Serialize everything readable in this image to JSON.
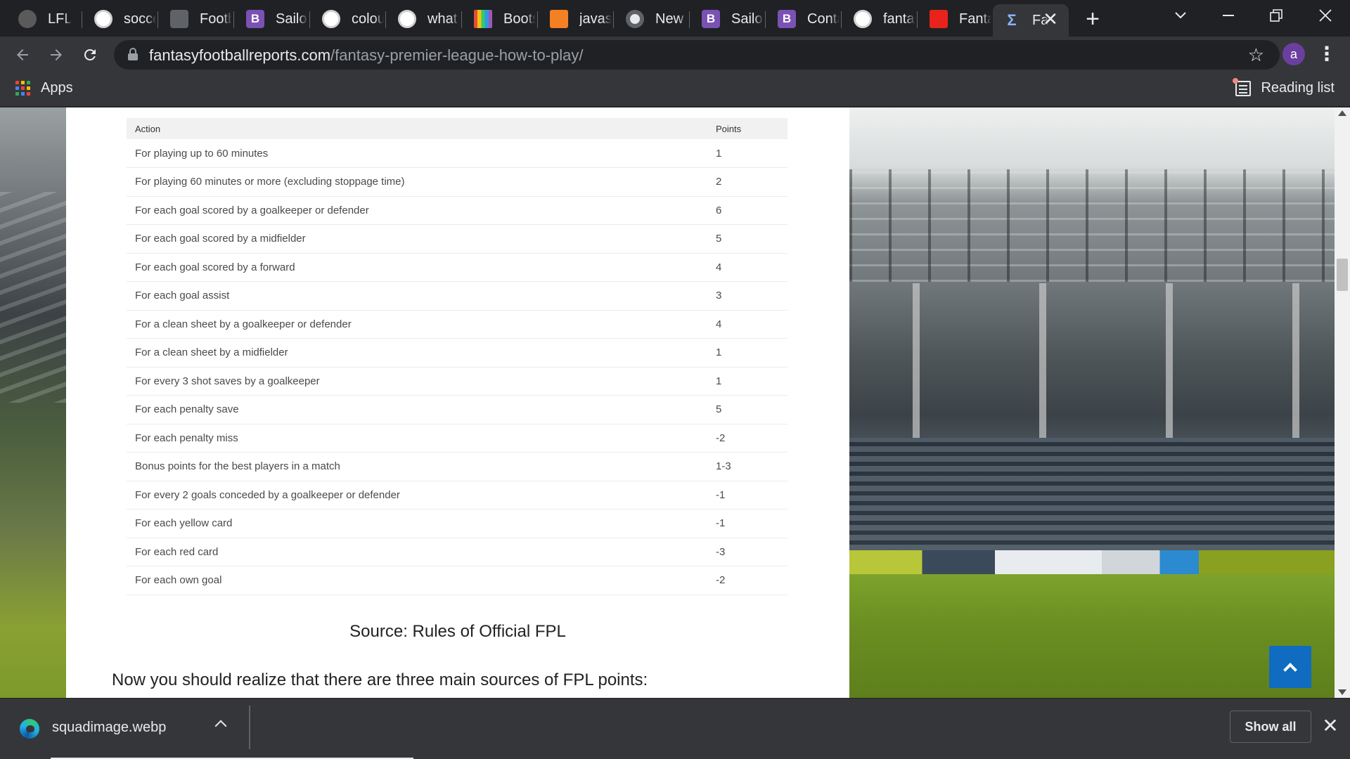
{
  "browser": {
    "tabs": [
      {
        "title": "LFL",
        "favicon": "lfl-logo-icon"
      },
      {
        "title": "soccer",
        "favicon": "google-icon"
      },
      {
        "title": "Footb",
        "favicon": "football-icon"
      },
      {
        "title": "Sailor",
        "favicon": "bootstrap-icon"
      },
      {
        "title": "colour",
        "favicon": "google-icon"
      },
      {
        "title": "what i",
        "favicon": "google-icon"
      },
      {
        "title": "Boots",
        "favicon": "colour-stripes-icon"
      },
      {
        "title": "javasc",
        "favicon": "stackoverflow-icon"
      },
      {
        "title": "New T",
        "favicon": "chrome-icon"
      },
      {
        "title": "Sailor",
        "favicon": "bootstrap-icon"
      },
      {
        "title": "Conta",
        "favicon": "bootstrap-icon"
      },
      {
        "title": "fantas",
        "favicon": "google-icon"
      },
      {
        "title": "Fanta",
        "favicon": "fpl-icon"
      },
      {
        "title": "Fa",
        "favicon": "sigma-icon"
      }
    ],
    "bootstrap_letter": "B",
    "sigma_glyph": "Σ",
    "new_tab_glyph": "+",
    "close_glyph": "✕",
    "url_host": "fantasyfootballreports.com",
    "url_path": "/fantasy-premier-league-how-to-play/",
    "avatar_letter": "a",
    "kebab_glyph": "⋮",
    "star_glyph": "☆",
    "bookmarks": {
      "apps_label": "Apps",
      "reading_list_label": "Reading list"
    }
  },
  "page": {
    "table": {
      "headers": [
        "Action",
        "Points"
      ],
      "rows": [
        [
          "For playing up to 60 minutes",
          "1"
        ],
        [
          "For playing 60 minutes or more (excluding stoppage time)",
          "2"
        ],
        [
          "For each goal scored by a goalkeeper or defender",
          "6"
        ],
        [
          "For each goal scored by a midfielder",
          "5"
        ],
        [
          "For each goal scored by a forward",
          "4"
        ],
        [
          "For each goal assist",
          "3"
        ],
        [
          "For a clean sheet by a goalkeeper or defender",
          "4"
        ],
        [
          "For a clean sheet by a midfielder",
          "1"
        ],
        [
          "For every 3 shot saves by a goalkeeper",
          "1"
        ],
        [
          "For each penalty save",
          "5"
        ],
        [
          "For each penalty miss",
          "-2"
        ],
        [
          "Bonus points for the best players in a match",
          "1-3"
        ],
        [
          "For every 2 goals conceded by a goalkeeper or defender",
          "-1"
        ],
        [
          "For each yellow card",
          "-1"
        ],
        [
          "For each red card",
          "-3"
        ],
        [
          "For each own goal",
          "-2"
        ]
      ]
    },
    "source_text": "Source: Rules of Official FPL",
    "paragraph": "Now you should realize that there are three main sources of FPL points:"
  },
  "downloads": {
    "file_name": "squadimage.webp",
    "show_all_label": "Show all",
    "progress": 1.0
  },
  "colors": {
    "accent": "#0f6cc0",
    "chrome_dark": "#202124",
    "chrome_mid": "#35363a"
  }
}
